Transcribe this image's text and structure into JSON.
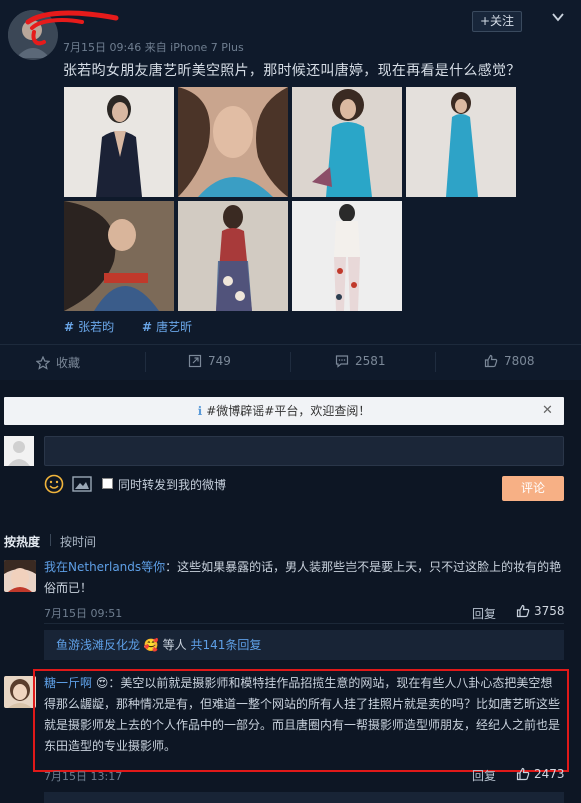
{
  "post": {
    "meta": "7月15日 09:46 来自 iPhone 7 Plus",
    "follow_label": "+关注",
    "text": "张若昀女朋友唐艺昕美空照片，那时候还叫唐婷，现在再看是什么感觉？",
    "tags": [
      "张若昀",
      "唐艺昕"
    ]
  },
  "actions": {
    "favorite": "收藏",
    "repost_count": "749",
    "comment_count": "2581",
    "like_count": "7808"
  },
  "notice": {
    "text": "#微博辟谣#平台，欢迎查阅！",
    "close": "✕"
  },
  "composer": {
    "repost_label": "同时转发到我的微博",
    "submit_label": "评论"
  },
  "sort": {
    "hot": "按热度",
    "time": "按时间"
  },
  "comments": [
    {
      "user": "我在Netherlands等你",
      "text_line1": "：这些如果暴露的话，男人装那些岂不是要上天，只不过这脸上的妆有的艳",
      "text_line2": "俗而已！",
      "time": "7月15日 09:51",
      "reply": "回复",
      "likes": "3758"
    },
    {
      "user": "糖一斤啊",
      "text_line1": "：美空以前就是摄影师和模特挂作品招揽生意的网站，现在有些人八卦心态把美空想",
      "text_line2": "得那么龌龊，那种情况是有，但难道一整个网站的所有人挂了挂照片就是卖的吗？比如唐艺昕这些",
      "text_line3": "就是摄影师发上去的个人作品中的一部分。而且唐圈内有一帮摄影师造型师朋友，经纪人之前也是",
      "text_line4": "东田造型的专业摄影师。",
      "time": "7月15日 13:17",
      "reply": "回复",
      "likes": "2473"
    }
  ],
  "more_replies": {
    "user": "鱼游浅滩反化龙",
    "suffix": "等人",
    "count": "共141条回复"
  },
  "colors": {
    "background": "#0f1a2b",
    "link": "#5e9fe6",
    "highlight": "#e01919",
    "submit": "#f7b085"
  }
}
